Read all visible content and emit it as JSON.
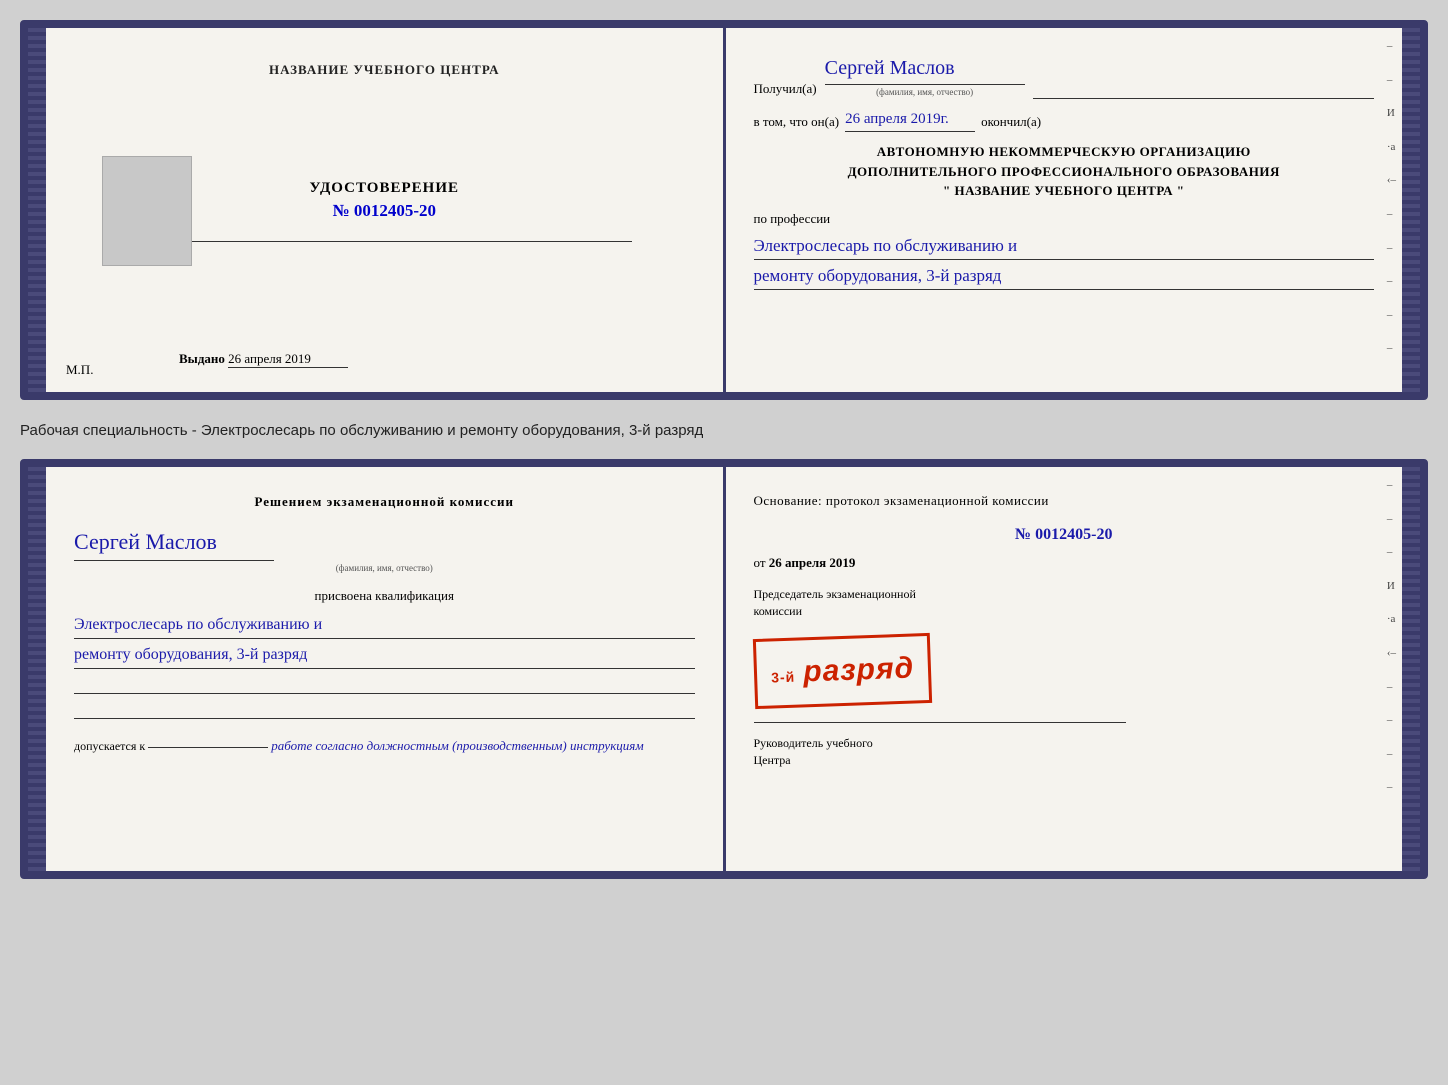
{
  "card1": {
    "left": {
      "school_name": "НАЗВАНИЕ УЧЕБНОГО ЦЕНТРА",
      "udost_title": "УДОСТОВЕРЕНИЕ",
      "udost_num": "№ 0012405-20",
      "issued_label": "Выдано",
      "issued_date": "26 апреля 2019",
      "mp_label": "М.П."
    },
    "right": {
      "poluchil_label": "Получил(а)",
      "recipient_name": "Сергей Маслов",
      "fio_label": "(фамилия, имя, отчество)",
      "vtom_label": "в том, что он(а)",
      "completion_date": "26 апреля 2019г.",
      "okonchil_label": "окончил(а)",
      "org_line1": "АВТОНОМНУЮ НЕКОММЕРЧЕСКУЮ ОРГАНИЗАЦИЮ",
      "org_line2": "ДОПОЛНИТЕЛЬНОГО ПРОФЕССИОНАЛЬНОГО ОБРАЗОВАНИЯ",
      "org_line3": "\"   НАЗВАНИЕ УЧЕБНОГО ЦЕНТРА   \"",
      "po_professii_label": "по профессии",
      "profession_line1": "Электрослесарь по обслуживанию и",
      "profession_line2": "ремонту оборудования, 3-й разряд"
    }
  },
  "between": {
    "label": "Рабочая специальность - Электрослесарь по обслуживанию и ремонту оборудования, 3-й разряд"
  },
  "card2": {
    "left": {
      "resheniem_title": "Решением экзаменационной  комиссии",
      "recipient_name": "Сергей Маслов",
      "fio_label": "(фамилия, имя, отчество)",
      "prisvoena_label": "присвоена квалификация",
      "profession_line1": "Электрослесарь по обслуживанию и",
      "profession_line2": "ремонту оборудования, 3-й разряд",
      "dopusk_label": "допускается к",
      "dopusk_text": "работе согласно должностным (производственным) инструкциям"
    },
    "right": {
      "osnovanie_label": "Основание: протокол экзаменационной  комиссии",
      "doc_num": "№  0012405-20",
      "ot_label": "от",
      "ot_date": "26 апреля 2019",
      "predsedatel_line1": "Председатель экзаменационной",
      "predsedatel_line2": "комиссии",
      "stamp_text": "3-й разряд",
      "stamp_small": "3-й",
      "stamp_big": "разряд",
      "rukovoditel_line1": "Руководитель учебного",
      "rukovoditel_line2": "Центра"
    }
  }
}
